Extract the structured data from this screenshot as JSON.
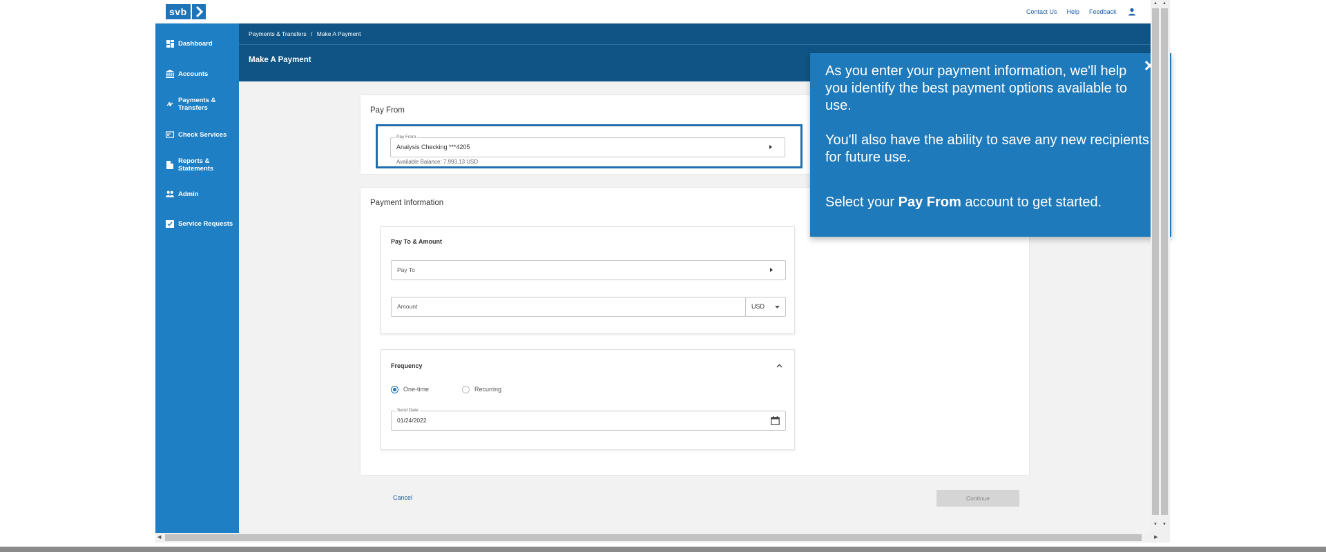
{
  "brand": {
    "logo_text": "svb",
    "accent": "#1f7fc4",
    "header_color": "#0f5484"
  },
  "top_links": {
    "contact": "Contact Us",
    "help": "Help",
    "feedback": "Feedback"
  },
  "sidebar": {
    "items": [
      {
        "label": "Dashboard",
        "icon": "dashboard-icon"
      },
      {
        "label": "Accounts",
        "icon": "bank-icon"
      },
      {
        "label": "Payments & Transfers",
        "icon": "transfer-icon"
      },
      {
        "label": "Check Services",
        "icon": "check-icon"
      },
      {
        "label": "Reports & Statements",
        "icon": "document-icon"
      },
      {
        "label": "Admin",
        "icon": "people-icon"
      },
      {
        "label": "Service Requests",
        "icon": "clipboard-check-icon"
      }
    ]
  },
  "header": {
    "breadcrumb_parent": "Payments & Transfers",
    "breadcrumb_sep": "/",
    "breadcrumb_current": "Make A Payment",
    "title": "Make A Payment"
  },
  "pay_from": {
    "section_title": "Pay From",
    "field_label": "Pay From",
    "value": "Analysis Checking ***4205",
    "balance": "Available Balance: 7,993.13 USD"
  },
  "payment_info": {
    "section_title": "Payment Information",
    "pay_to_amount_title": "Pay To & Amount",
    "pay_to_placeholder": "Pay To",
    "amount_placeholder": "Amount",
    "currency": "USD"
  },
  "frequency": {
    "title": "Frequency",
    "options": [
      {
        "label": "One-time",
        "selected": true
      },
      {
        "label": "Recurring",
        "selected": false
      }
    ],
    "send_date_label": "Send Date",
    "send_date": "01/24/2022"
  },
  "actions": {
    "cancel": "Cancel",
    "continue": "Continue"
  },
  "tooltip": {
    "para1": "As you enter your payment information, we'll help you identify the best payment options available to use.",
    "para2": "You'll also have the ability to save any new recipients for future use.",
    "para3_prefix": "Select your ",
    "para3_bold": "Pay From",
    "para3_suffix": " account to get started.",
    "close": "✕"
  }
}
